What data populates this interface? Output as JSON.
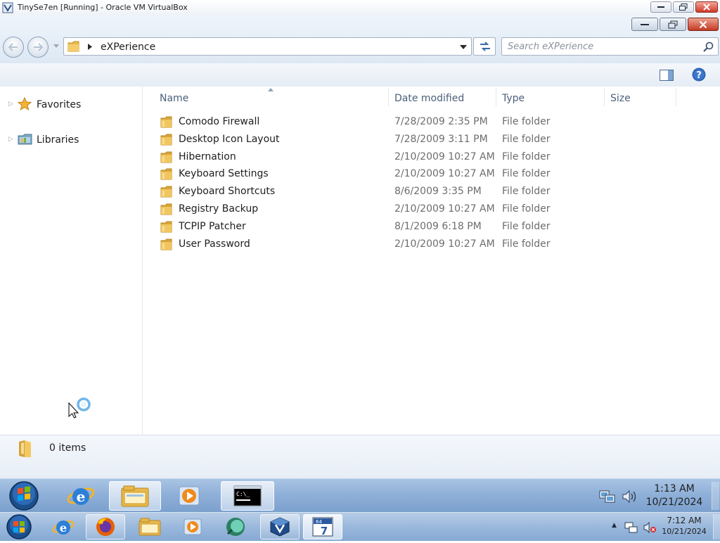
{
  "host_window": {
    "title": "TinySe7en [Running] - Oracle VM VirtualBox",
    "icon": "virtualbox-icon"
  },
  "explorer": {
    "address": {
      "path": "eXPerience"
    },
    "search": {
      "placeholder": "Search eXPerience"
    },
    "nav_pane": {
      "items": [
        {
          "label": "Favorites",
          "icon": "star-icon"
        },
        {
          "label": "Libraries",
          "icon": "libraries-icon"
        }
      ]
    },
    "columns": {
      "name": "Name",
      "date_modified": "Date modified",
      "type": "Type",
      "size": "Size"
    },
    "files": [
      {
        "name": "Comodo Firewall",
        "date": "7/28/2009 2:35 PM",
        "type": "File folder"
      },
      {
        "name": "Desktop Icon Layout",
        "date": "7/28/2009 3:11 PM",
        "type": "File folder"
      },
      {
        "name": "Hibernation",
        "date": "2/10/2009 10:27 AM",
        "type": "File folder"
      },
      {
        "name": "Keyboard Settings",
        "date": "2/10/2009 10:27 AM",
        "type": "File folder"
      },
      {
        "name": "Keyboard Shortcuts",
        "date": "8/6/2009 3:35 PM",
        "type": "File folder"
      },
      {
        "name": "Registry Backup",
        "date": "2/10/2009 10:27 AM",
        "type": "File folder"
      },
      {
        "name": "TCPIP Patcher",
        "date": "8/1/2009 6:18 PM",
        "type": "File folder"
      },
      {
        "name": "User Password",
        "date": "2/10/2009 10:27 AM",
        "type": "File folder"
      }
    ],
    "details": {
      "item_count": "0 items"
    }
  },
  "guest_taskbar": {
    "buttons": [
      "start-orb",
      "internet-explorer-icon",
      "windows-explorer-icon",
      "media-player-icon",
      "command-prompt-icon"
    ],
    "clock": {
      "time": "1:13 AM",
      "date": "10/21/2024"
    }
  },
  "host_taskbar": {
    "buttons": [
      "start-orb",
      "internet-explorer-icon",
      "firefox-icon",
      "windows-explorer-icon",
      "media-player-icon",
      "app-icon",
      "virtualbox-icon",
      "tinyse7en-icon"
    ],
    "clock": {
      "time": "7:12 AM",
      "date": "10/21/2024"
    }
  },
  "colors": {
    "taskbar": "#8fb0d8",
    "folder": "#e8b84a",
    "header_text": "#4c607a"
  }
}
